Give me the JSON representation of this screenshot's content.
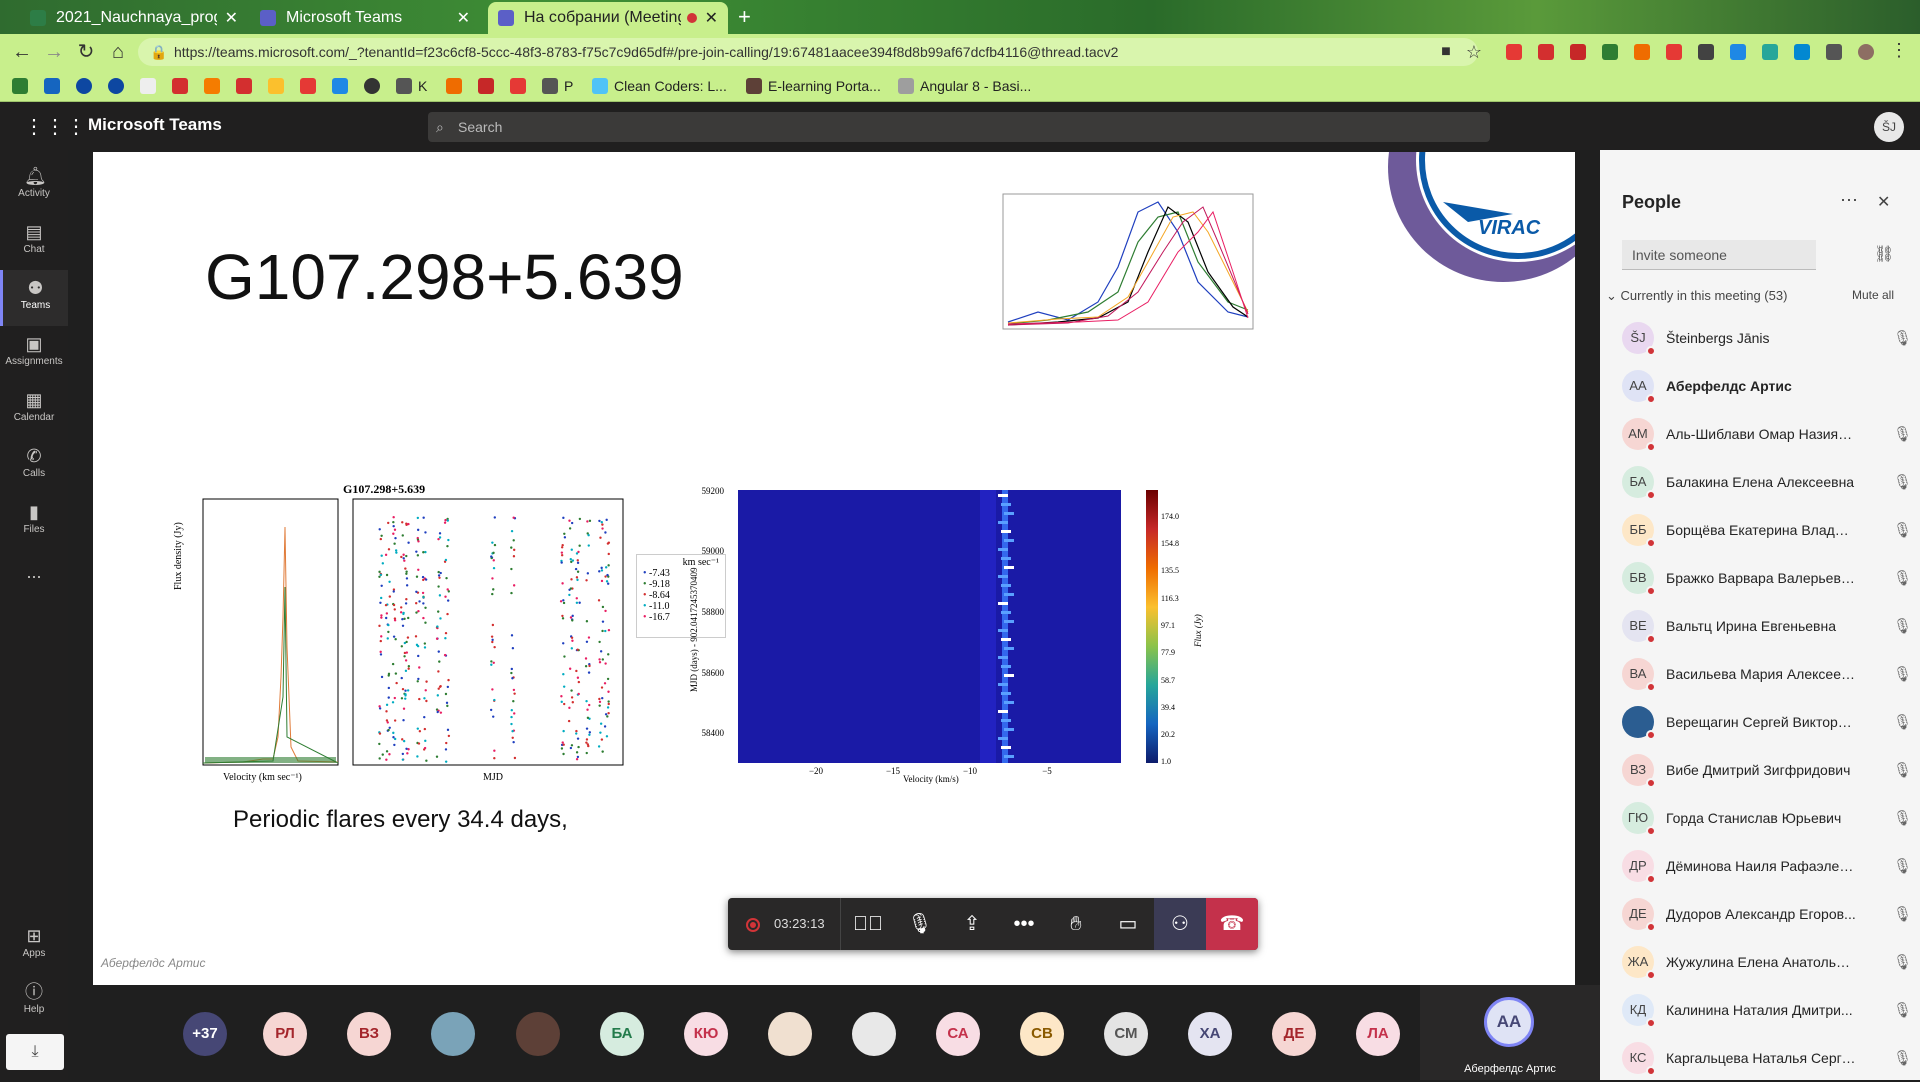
{
  "browser": {
    "tabs": [
      {
        "label": "2021_Nauchnaya_program",
        "active": false
      },
      {
        "label": "Microsoft Teams",
        "active": false
      },
      {
        "label": "На собрании (Meeting",
        "active": true
      }
    ],
    "url": "https://teams.microsoft.com/_?tenantId=f23c6cf8-5ccc-48f3-8783-f75c7c9d65df#/pre-join-calling/19:67481aacee394f8d8b99af67dcfb4116@thread.tacv2",
    "bookmarks": [
      "K",
      "P",
      "Clean Coders: L...",
      "E-learning Porta...",
      "Angular 8 - Basi..."
    ]
  },
  "teams": {
    "app_name": "Microsoft Teams",
    "search_placeholder": "Search",
    "me_initials": "ŠJ",
    "rail": [
      {
        "label": "Activity",
        "icon": "bell-icon"
      },
      {
        "label": "Chat",
        "icon": "chat-icon"
      },
      {
        "label": "Teams",
        "icon": "teams-icon"
      },
      {
        "label": "Assignments",
        "icon": "assignments-icon"
      },
      {
        "label": "Calendar",
        "icon": "calendar-icon"
      },
      {
        "label": "Calls",
        "icon": "phone-icon"
      },
      {
        "label": "Files",
        "icon": "file-icon"
      },
      {
        "label": "...",
        "icon": "more-icon"
      },
      {
        "label": "Apps",
        "icon": "apps-icon"
      },
      {
        "label": "Help",
        "icon": "help-icon"
      }
    ]
  },
  "slide": {
    "title": "G107.298+5.639",
    "caption": "Periodic flares every 34.4 days,",
    "logo_text": "VIRAC",
    "presenter_watermark": "Аберфелдс Артис",
    "left_panel": {
      "title": "G107.298+5.639",
      "ylabel": "Flux density (Jy)",
      "xlabel_left": "Velocity (km sec⁻¹)",
      "xlabel_mid": "MJD",
      "legend_title": "km sec⁻¹",
      "legend": [
        "-7.43",
        "-9.18",
        "-8.64",
        "-11.0",
        "-16.7"
      ]
    },
    "heatmap": {
      "yticks": [
        "59200",
        "59000",
        "58800",
        "58600",
        "58400"
      ],
      "xticks": [
        "−20",
        "−15",
        "−10",
        "−5"
      ],
      "xlabel": "Velocity (km/s)",
      "ylabel": "MJD (days) - 902.0417245370409",
      "colorbar_ticks": [
        "174.0",
        "154.8",
        "135.5",
        "116.3",
        "97.1",
        "77.9",
        "58.7",
        "39.4",
        "20.2",
        "1.0"
      ],
      "colorbar_label": "Flux (Jy)"
    }
  },
  "call": {
    "timer": "03:23:13",
    "controls": [
      "video-off",
      "mute",
      "share",
      "more",
      "raise-hand",
      "chat",
      "participants",
      "hang-up"
    ]
  },
  "strip": {
    "overflow": "+37",
    "participants": [
      "РЛ",
      "ВЗ",
      "",
      "",
      "БА",
      "КЮ",
      "",
      "",
      "СА",
      "СВ",
      "СМ",
      "ХА",
      "ДЕ",
      "ЛА"
    ],
    "active_initials": "АА",
    "active_name": "Аберфелдс Артис"
  },
  "people": {
    "title": "People",
    "invite_placeholder": "Invite someone",
    "section": "Currently in this meeting (53)",
    "mute_all": "Mute all",
    "list": [
      {
        "initials": "ŠJ",
        "name": "Šteinbergs Jānis",
        "color": "#e9d8f0"
      },
      {
        "initials": "АА",
        "name": "Аберфелдс Артис",
        "color": "#dfe3f5",
        "bold": true
      },
      {
        "initials": "АМ",
        "name": "Аль-Шиблави Омар Назиях ...",
        "color": "#f6d6d3"
      },
      {
        "initials": "БА",
        "name": "Балакина Елена Алексеевна",
        "color": "#d6ecdf"
      },
      {
        "initials": "ББ",
        "name": "Борщёва Екатерина Владим...",
        "color": "#fde7c7"
      },
      {
        "initials": "БВ",
        "name": "Бражко Варвара Валерьевна",
        "color": "#d6ecdf"
      },
      {
        "initials": "ВЕ",
        "name": "Вальтц Ирина Евгеньевна",
        "color": "#e4e4f1"
      },
      {
        "initials": "ВА",
        "name": "Васильева Мария Алексеевна",
        "color": "#f6d6d3"
      },
      {
        "initials": "",
        "name": "Верещагин Сергей Викторо...",
        "color": "#2b5d91"
      },
      {
        "initials": "ВЗ",
        "name": "Вибе Дмитрий Зигфридович",
        "color": "#f6d6d3"
      },
      {
        "initials": "ГЮ",
        "name": "Горда Станислав Юрьевич",
        "color": "#d6ecdf"
      },
      {
        "initials": "ДР",
        "name": "Дёминова Наиля Рафаэлевна",
        "color": "#f8dde4"
      },
      {
        "initials": "ДЕ",
        "name": "Дудоров Александр Егоров...",
        "color": "#f6d6d3"
      },
      {
        "initials": "ЖА",
        "name": "Жужулина Елена Анатольев...",
        "color": "#fde7c7"
      },
      {
        "initials": "КД",
        "name": "Калинина Наталия Дмитри...",
        "color": "#dfe9f7"
      },
      {
        "initials": "КС",
        "name": "Каргальцева Наталья Серге...",
        "color": "#f8dde4"
      }
    ]
  }
}
